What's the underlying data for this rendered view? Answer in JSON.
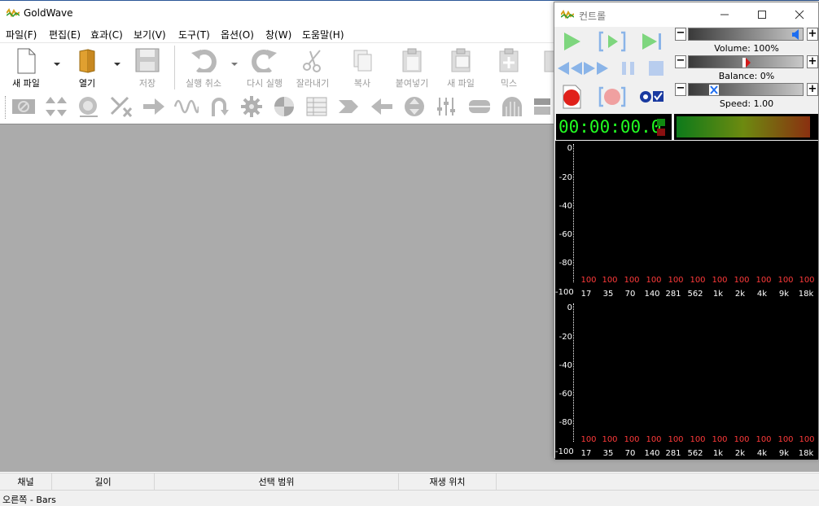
{
  "app": {
    "title": "GoldWave"
  },
  "menu": [
    "파일(F)",
    "편집(E)",
    "효과(C)",
    "보기(V)",
    "도구(T)",
    "옵션(O)",
    "창(W)",
    "도움말(H)"
  ],
  "toolbar": {
    "new": "새 파일",
    "open": "열기",
    "save": "저장",
    "undo": "실행 취소",
    "redo": "다시 실행",
    "cut": "잘라내기",
    "copy": "복사",
    "paste": "붙여넣기",
    "paste_new": "새 파일",
    "mix": "믹스"
  },
  "status": {
    "channel": "채널",
    "length": "길이",
    "selection": "선택 범위",
    "position": "재생 위치",
    "bottom_text": "오른쪽 - Bars"
  },
  "control": {
    "title": "컨트롤",
    "volume": "Volume: 100%",
    "balance": "Balance: 0%",
    "speed": "Speed: 1.00",
    "time": "00:00:00.0",
    "spectrum_ylabels": [
      "0",
      "-20",
      "-40",
      "-60",
      "-80",
      "-100"
    ],
    "spectrum_xlabels": [
      "17",
      "35",
      "70",
      "140",
      "281",
      "562",
      "1k",
      "2k",
      "4k",
      "9k",
      "18k"
    ],
    "spectrum_values": [
      "100",
      "100",
      "100",
      "100",
      "100",
      "100",
      "100",
      "100",
      "100",
      "100",
      "100"
    ],
    "colors": {
      "time_text": "#22ff22",
      "record": "#e0201a",
      "play": "#7ed67e",
      "value_text": "#ff3a3a"
    }
  }
}
